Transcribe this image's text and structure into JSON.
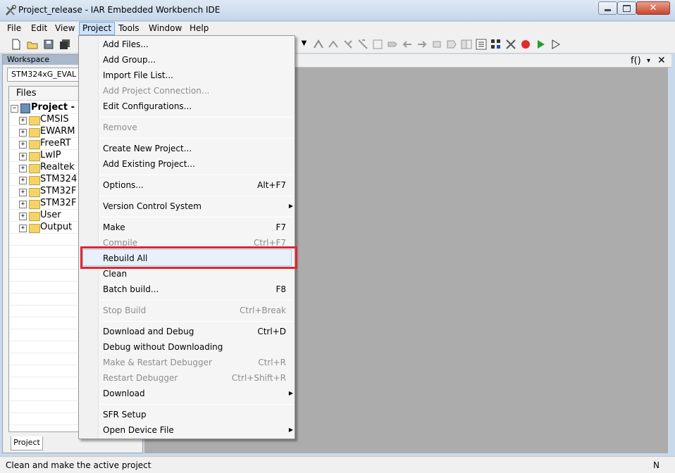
{
  "window": {
    "title": "Project_release - IAR Embedded Workbench IDE",
    "app_icon": "iar-icon",
    "min_icon": "minimize-icon",
    "max_icon": "maximize-icon",
    "close_icon": "close-icon"
  },
  "menubar": {
    "items": [
      "File",
      "Edit",
      "View",
      "Project",
      "Tools",
      "Window",
      "Help"
    ],
    "active": "Project"
  },
  "workspace": {
    "header": "Workspace",
    "configuration": "STM324xG_EVAL",
    "files_header": "Files",
    "root": "Project -",
    "groups": [
      "CMSIS",
      "EWARM",
      "FreeRT",
      "LwIP",
      "Realtek",
      "STM324",
      "STM32F",
      "STM32F",
      "User",
      "Output"
    ],
    "tab": "Project"
  },
  "editor": {
    "function_label": "f()",
    "dropdown_arrow": "▾",
    "close_glyph": "✕"
  },
  "project_menu": {
    "items": [
      {
        "label": "Add Files...",
        "shortcut": "",
        "disabled": false
      },
      {
        "label": "Add Group...",
        "shortcut": "",
        "disabled": false
      },
      {
        "label": "Import File List...",
        "shortcut": "",
        "disabled": false
      },
      {
        "label": "Add Project Connection...",
        "shortcut": "",
        "disabled": true
      },
      {
        "label": "Edit Configurations...",
        "shortcut": "",
        "disabled": false
      },
      {
        "label": "Remove",
        "shortcut": "",
        "disabled": true
      },
      {
        "label": "Create New Project...",
        "shortcut": "",
        "disabled": false
      },
      {
        "label": "Add Existing Project...",
        "shortcut": "",
        "disabled": false
      },
      {
        "label": "Options...",
        "shortcut": "Alt+F7",
        "disabled": false
      },
      {
        "label": "Version Control System",
        "shortcut": "",
        "disabled": false,
        "submenu": true
      },
      {
        "label": "Make",
        "shortcut": "F7",
        "disabled": false
      },
      {
        "label": "Compile",
        "shortcut": "Ctrl+F7",
        "disabled": true
      },
      {
        "label": "Rebuild All",
        "shortcut": "",
        "disabled": false
      },
      {
        "label": "Clean",
        "shortcut": "",
        "disabled": false
      },
      {
        "label": "Batch build...",
        "shortcut": "F8",
        "disabled": false
      },
      {
        "label": "Stop Build",
        "shortcut": "Ctrl+Break",
        "disabled": true
      },
      {
        "label": "Download and Debug",
        "shortcut": "Ctrl+D",
        "disabled": false
      },
      {
        "label": "Debug without Downloading",
        "shortcut": "",
        "disabled": false
      },
      {
        "label": "Make & Restart Debugger",
        "shortcut": "Ctrl+R",
        "disabled": true
      },
      {
        "label": "Restart Debugger",
        "shortcut": "Ctrl+Shift+R",
        "disabled": true
      },
      {
        "label": "Download",
        "shortcut": "",
        "disabled": false,
        "submenu": true
      },
      {
        "label": "SFR Setup",
        "shortcut": "",
        "disabled": false
      },
      {
        "label": "Open Device File",
        "shortcut": "",
        "disabled": false,
        "submenu": true
      }
    ],
    "highlighted": "Rebuild All",
    "submenu_arrow": "▶"
  },
  "status": {
    "text": "Clean and make the active project",
    "right": "N"
  },
  "colors": {
    "highlight_box": "#e0262f",
    "editor_bg": "#acacac",
    "menu_active": "#cde2f7"
  }
}
